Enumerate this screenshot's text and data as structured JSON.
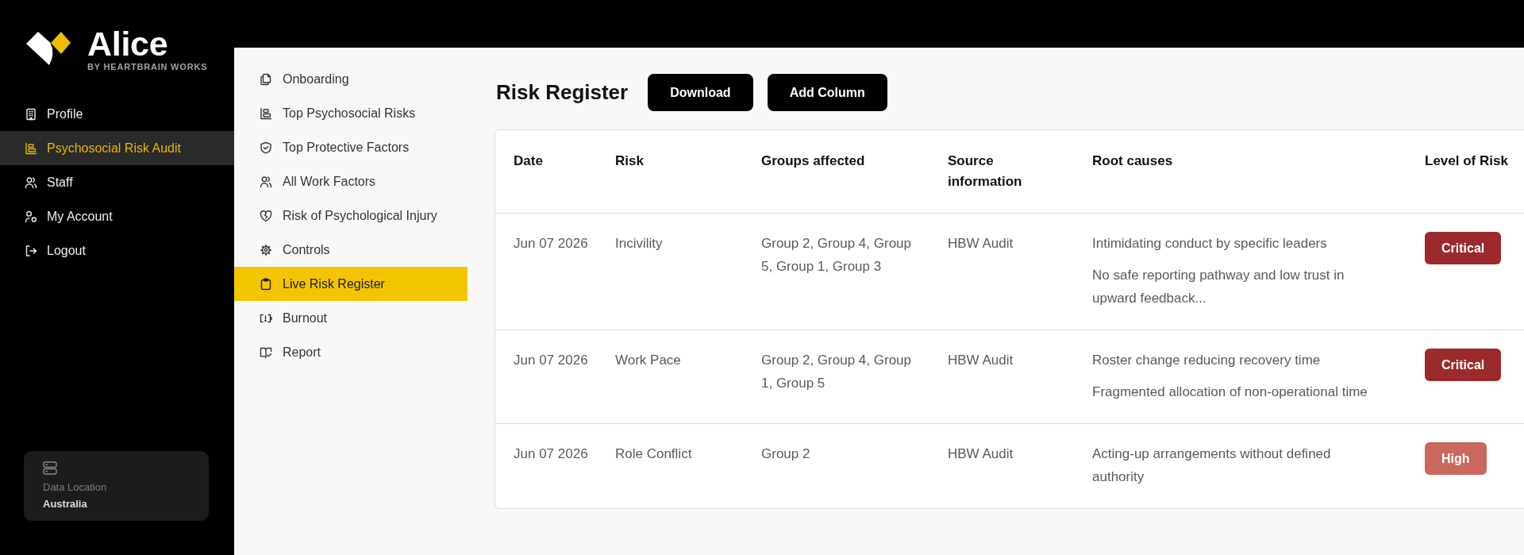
{
  "sidebar": {
    "brand": {
      "name": "Alice",
      "tagline": "BY HEARTBRAIN WORKS"
    },
    "items": [
      {
        "label": "Profile",
        "selected": false
      },
      {
        "label": "Psychosocial Risk Audit",
        "selected": true
      },
      {
        "label": "Staff",
        "selected": false
      },
      {
        "label": "My Account",
        "selected": false
      },
      {
        "label": "Logout",
        "selected": false
      }
    ],
    "data_location": {
      "label": "Data Location",
      "value": "Australia"
    }
  },
  "audit_nav": {
    "items": [
      {
        "label": "Onboarding",
        "selected": false
      },
      {
        "label": "Top Psychosocial Risks",
        "selected": false
      },
      {
        "label": "Top Protective Factors",
        "selected": false
      },
      {
        "label": "All Work Factors",
        "selected": false
      },
      {
        "label": "Risk of Psychological Injury",
        "selected": false
      },
      {
        "label": "Controls",
        "selected": false
      },
      {
        "label": "Live Risk Register",
        "selected": true
      },
      {
        "label": "Burnout",
        "selected": false
      },
      {
        "label": "Report",
        "selected": false
      }
    ]
  },
  "register": {
    "title": "Risk Register",
    "buttons": [
      "Download",
      "Add Column"
    ],
    "table": {
      "columns": [
        "Date",
        "Risk",
        "Groups affected",
        "Source information",
        "Root causes",
        "Level of Risk"
      ],
      "rows": [
        {
          "date": "Jun 07 2026",
          "risk": "Incivility",
          "groups_affected": "Group 2, Group 4, Group 5, Group 1, Group 3",
          "source": "HBW Audit",
          "root_causes": [
            "Intimidating conduct by specific leaders",
            "No safe reporting pathway and low trust in upward feedback..."
          ],
          "risk_level": {
            "label": "Critical",
            "color": "#9c2a2b"
          }
        },
        {
          "date": "Jun 07 2026",
          "risk": "Work Pace",
          "groups_affected": "Group 2, Group 4, Group 1, Group 5",
          "source": "HBW Audit",
          "root_causes": [
            "Roster change reducing recovery time",
            "Fragmented allocation of non-operational time"
          ],
          "risk_level": {
            "label": "Critical",
            "color": "#9c2a2b"
          }
        },
        {
          "date": "Jun 07 2026",
          "risk": "Role Conflict",
          "groups_affected": "Group 2",
          "source": "HBW Audit",
          "root_causes": [
            "Acting-up arrangements without defined authority"
          ],
          "risk_level": {
            "label": "High",
            "color": "#c8695b"
          }
        }
      ]
    }
  }
}
